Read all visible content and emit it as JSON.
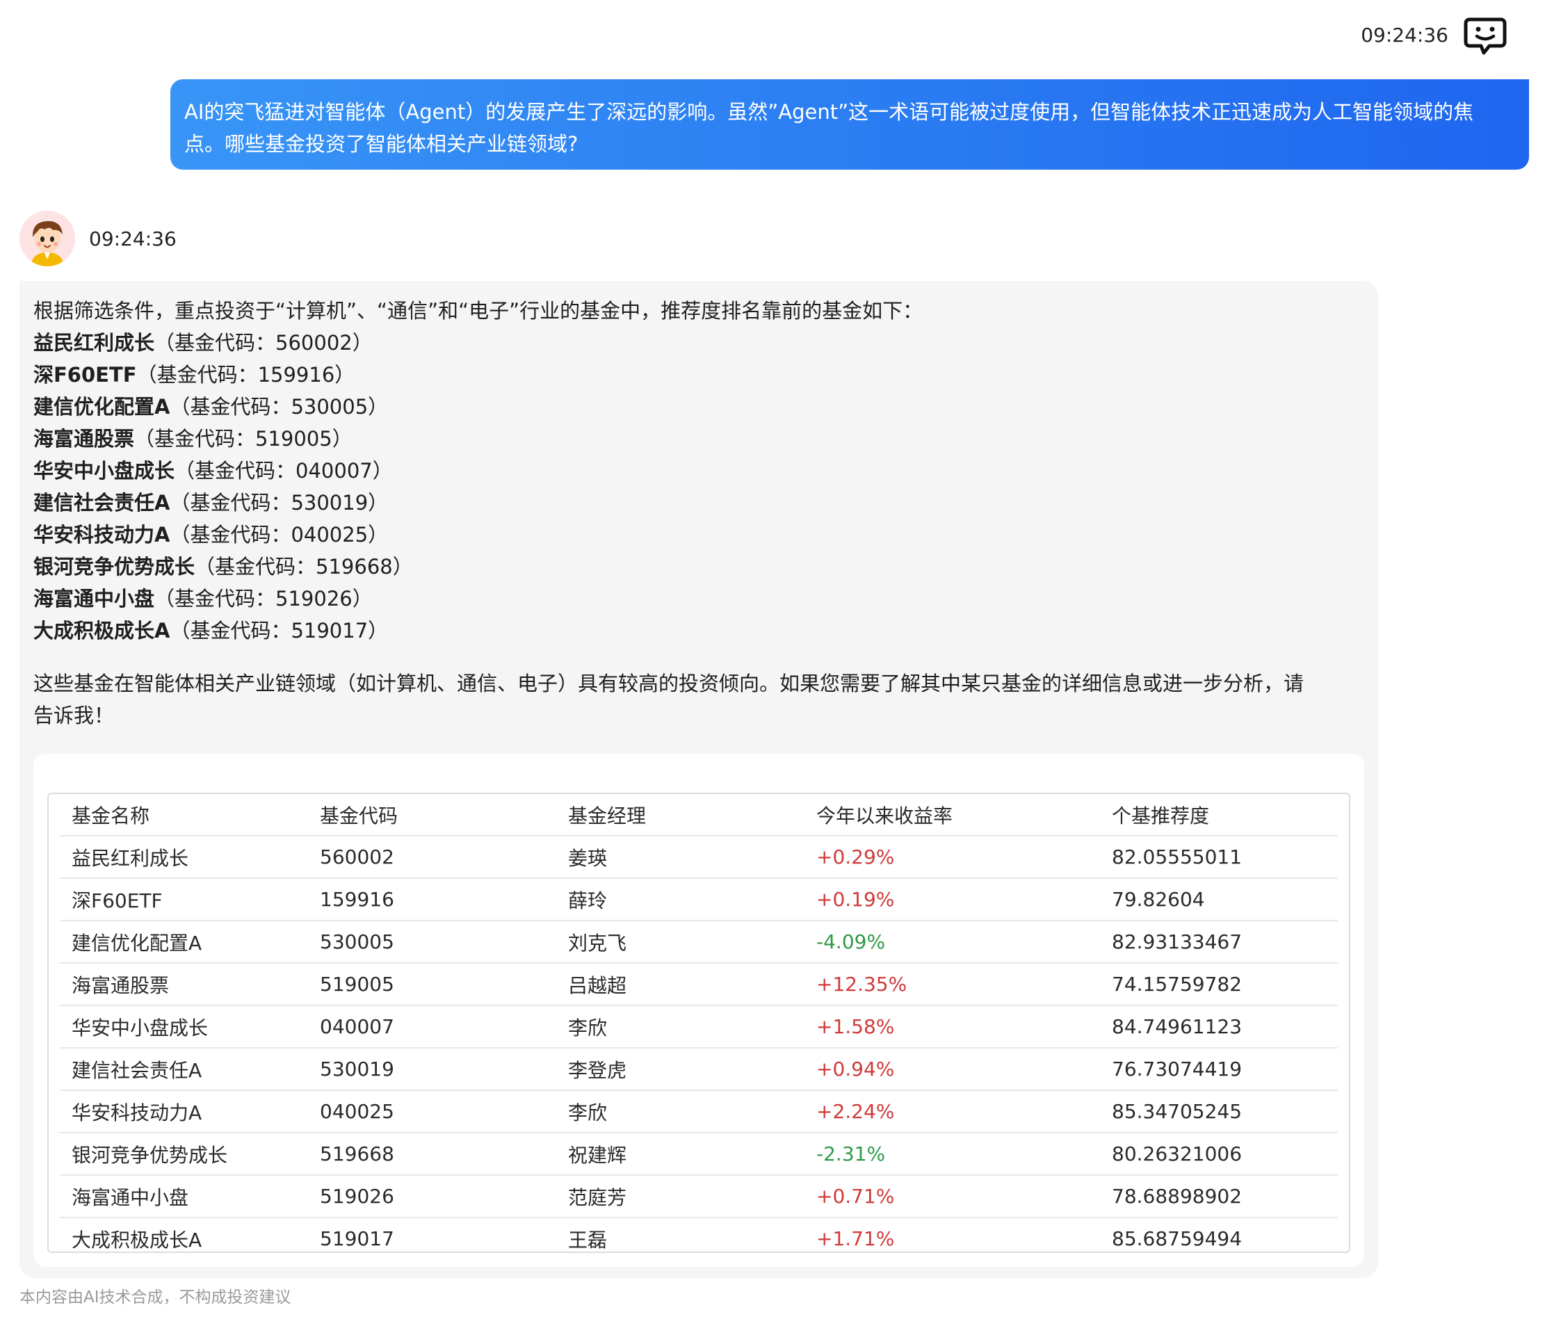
{
  "user_message": {
    "timestamp": "09:24:36",
    "text_line1": "AI的突飞猛进对智能体（Agent）的发展产生了深远的影响。虽然”Agent”这一术语可能被过度使用，但智能体技术正迅速成为人工智能领域的焦",
    "text_line2": "点。哪些基金投资了智能体相关产业链领域?"
  },
  "bot_message": {
    "timestamp": "09:24:36",
    "intro": "根据筛选条件，重点投资于“计算机”、“通信”和“电子”行业的基金中，推荐度排名靠前的基金如下：",
    "funds": [
      {
        "name": "益民红利成长",
        "code_text": "（基金代码：560002）"
      },
      {
        "name": "深F60ETF",
        "code_text": "（基金代码：159916）"
      },
      {
        "name": "建信优化配置A",
        "code_text": "（基金代码：530005）"
      },
      {
        "name": "海富通股票",
        "code_text": "（基金代码：519005）"
      },
      {
        "name": "华安中小盘成长",
        "code_text": "（基金代码：040007）"
      },
      {
        "name": "建信社会责任A",
        "code_text": "（基金代码：530019）"
      },
      {
        "name": "华安科技动力A",
        "code_text": "（基金代码：040025）"
      },
      {
        "name": "银河竞争优势成长",
        "code_text": "（基金代码：519668）"
      },
      {
        "name": "海富通中小盘",
        "code_text": "（基金代码：519026）"
      },
      {
        "name": "大成积极成长A",
        "code_text": "（基金代码：519017）"
      }
    ],
    "summary_line1": "这些基金在智能体相关产业链领域（如计算机、通信、电子）具有较高的投资倾向。如果您需要了解其中某只基金的详细信息或进一步分析，请",
    "summary_line2": "告诉我！"
  },
  "table": {
    "headers": [
      "基金名称",
      "基金代码",
      "基金经理",
      "今年以来收益率",
      "个基推荐度"
    ],
    "rows": [
      {
        "name": "益民红利成长",
        "code": "560002",
        "manager": "姜瑛",
        "ytd": "+0.29%",
        "score": "82.05555011"
      },
      {
        "name": "深F60ETF",
        "code": "159916",
        "manager": "薛玲",
        "ytd": "+0.19%",
        "score": "79.82604"
      },
      {
        "name": "建信优化配置A",
        "code": "530005",
        "manager": "刘克飞",
        "ytd": "-4.09%",
        "score": "82.93133467"
      },
      {
        "name": "海富通股票",
        "code": "519005",
        "manager": "吕越超",
        "ytd": "+12.35%",
        "score": "74.15759782"
      },
      {
        "name": "华安中小盘成长",
        "code": "040007",
        "manager": "李欣",
        "ytd": "+1.58%",
        "score": "84.74961123"
      },
      {
        "name": "建信社会责任A",
        "code": "530019",
        "manager": "李登虎",
        "ytd": "+0.94%",
        "score": "76.73074419"
      },
      {
        "name": "华安科技动力A",
        "code": "040025",
        "manager": "李欣",
        "ytd": "+2.24%",
        "score": "85.34705245"
      },
      {
        "name": "银河竞争优势成长",
        "code": "519668",
        "manager": "祝建辉",
        "ytd": "-2.31%",
        "score": "80.26321006"
      },
      {
        "name": "海富通中小盘",
        "code": "519026",
        "manager": "范庭芳",
        "ytd": "+0.71%",
        "score": "78.68898902"
      },
      {
        "name": "大成积极成长A",
        "code": "519017",
        "manager": "王磊",
        "ytd": "+1.71%",
        "score": "85.68759494"
      }
    ]
  },
  "colors": {
    "positive": "#d03a3a",
    "negative": "#2e9a47",
    "bubble_start": "#3895f6",
    "bubble_end": "#1f66ef"
  },
  "disclaimer": "本内容由AI技术合成，不构成投资建议",
  "icons": {
    "user_avatar": "chat-bubble-smile-icon",
    "bot_avatar": "cartoon-boy-avatar"
  }
}
